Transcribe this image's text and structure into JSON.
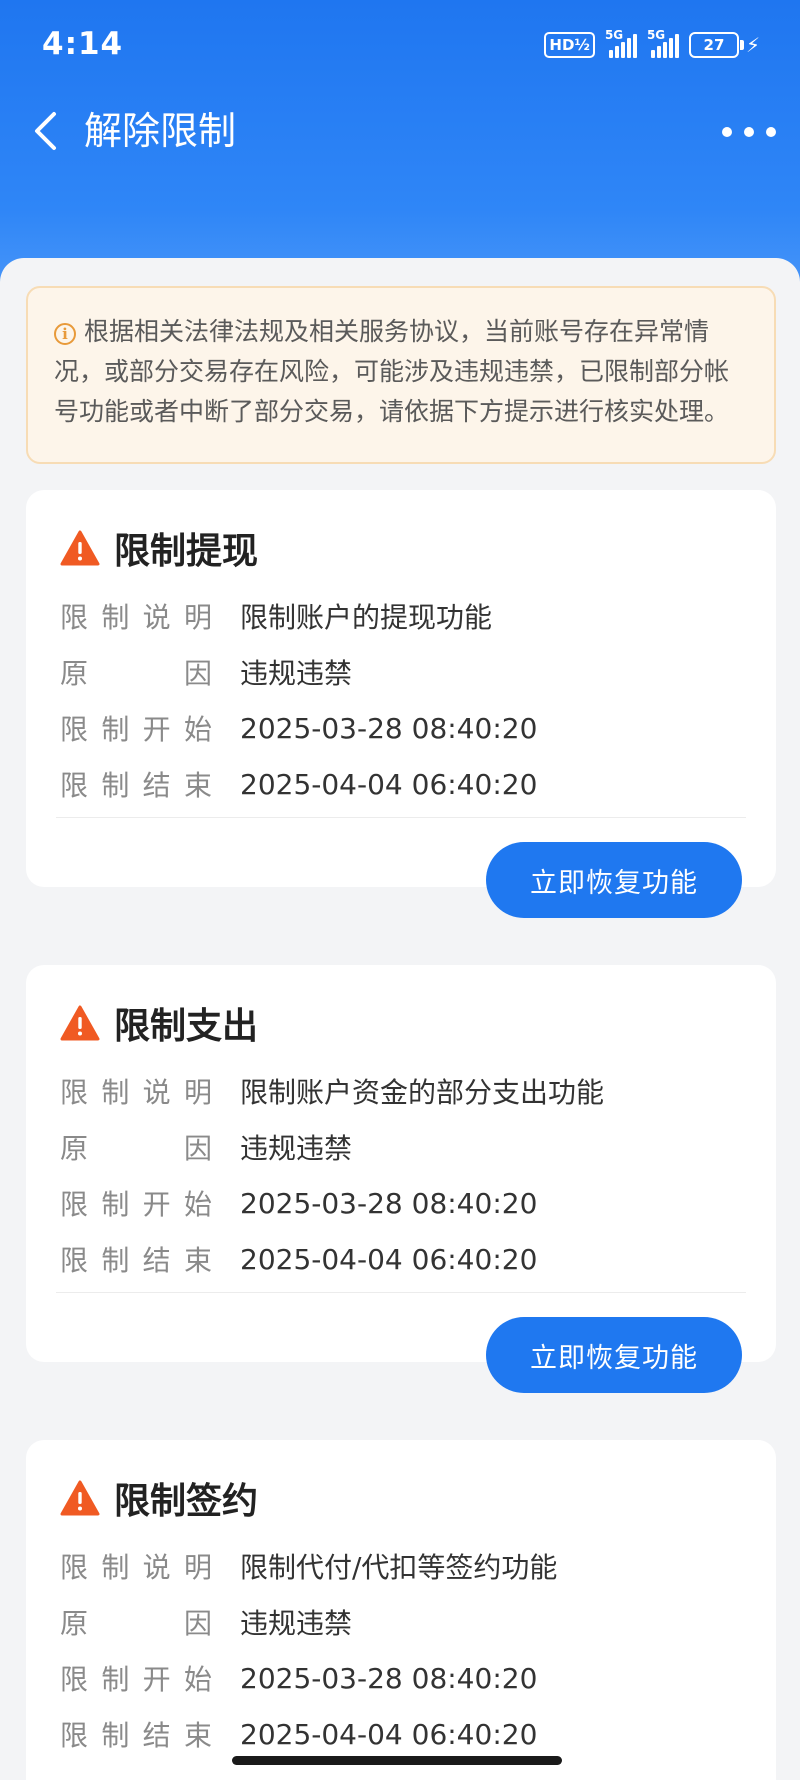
{
  "status_bar": {
    "time": "4:14",
    "hd_label": "HD½",
    "signal1_label": "5G",
    "signal2_label": "5G",
    "battery_level": "27",
    "battery_fraction": 0.27
  },
  "nav": {
    "title": "解除限制"
  },
  "notice": {
    "text": "根据相关法律法规及相关服务协议，当前账号存在异常情况，或部分交易存在风险，可能涉及违规违禁，已限制部分帐号功能或者中断了部分交易，请依据下方提示进行核实处理。"
  },
  "labels": {
    "desc": "限制说明",
    "reason": "原因",
    "start": "限制开始",
    "end": "限制结束"
  },
  "cards": [
    {
      "title": "限制提现",
      "desc": "限制账户的提现功能",
      "reason": "违规违禁",
      "start": "2025-03-28 08:40:20",
      "end": "2025-04-04 06:40:20",
      "button": "立即恢复功能"
    },
    {
      "title": "限制支出",
      "desc": "限制账户资金的部分支出功能",
      "reason": "违规违禁",
      "start": "2025-03-28 08:40:20",
      "end": "2025-04-04 06:40:20",
      "button": "立即恢复功能"
    },
    {
      "title": "限制签约",
      "desc": "限制代付/代扣等签约功能",
      "reason": "违规违禁",
      "start": "2025-03-28 08:40:20",
      "end": "2025-04-04 06:40:20"
    }
  ],
  "colors": {
    "header_blue": "#1f76f0",
    "button_blue": "#1f78f0",
    "warning_orange": "#f05a23",
    "notice_bg": "#fdf5ea"
  }
}
